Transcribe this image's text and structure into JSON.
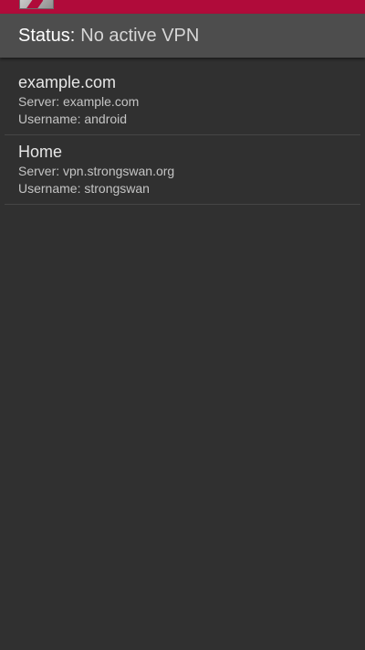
{
  "status_bar": {
    "label": "Status:",
    "value": "No active VPN"
  },
  "profiles": [
    {
      "name": "example.com",
      "server": "Server: example.com",
      "username": "Username: android"
    },
    {
      "name": "Home",
      "server": "Server: vpn.strongswan.org",
      "username": "Username: strongswan"
    }
  ],
  "colors": {
    "action_bar": "#b00b3a",
    "status_bar": "#4d4d4d",
    "background": "#303030"
  },
  "icons": {
    "app_icon": "strongswan-app-icon"
  }
}
